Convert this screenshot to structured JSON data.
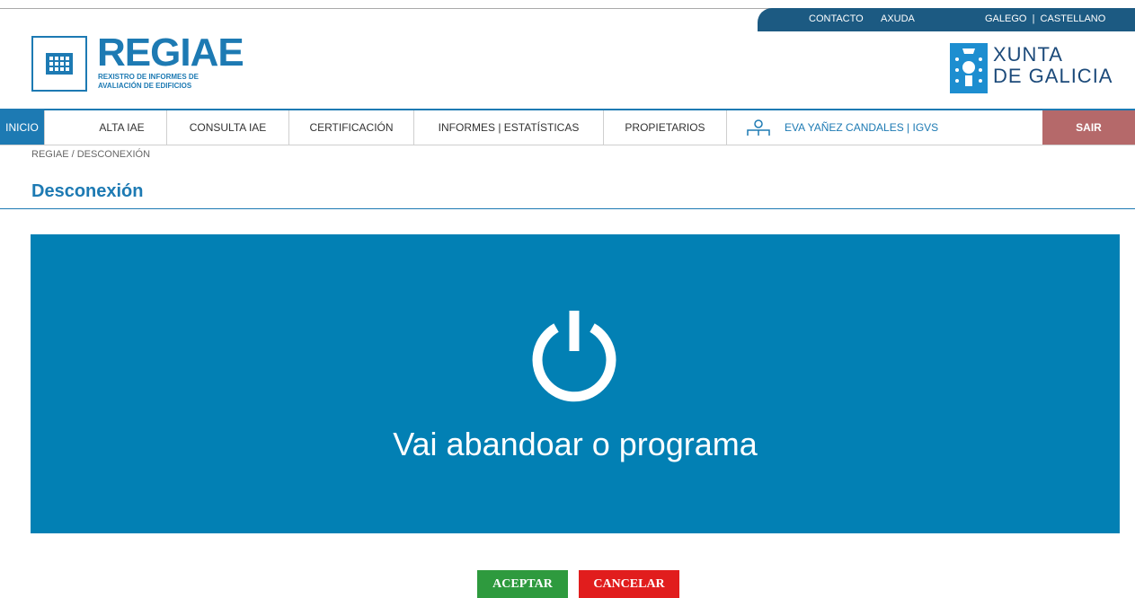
{
  "top_links": {
    "contacto": "CONTACTO",
    "axuda": "AXUDA",
    "languages": "GALEGO  |  CASTELLANO"
  },
  "brand": {
    "title": "REGIAE",
    "subtitle_line1": "REXISTRO DE INFORMES DE",
    "subtitle_line2": "AVALIACIÓN DE EDIFICIOS",
    "xunta_line1": "XUNTA",
    "xunta_line2": "DE GALICIA"
  },
  "nav": {
    "items": [
      {
        "label": "INICIO"
      },
      {
        "label": "ALTA IAE"
      },
      {
        "label": "CONSULTA IAE"
      },
      {
        "label": "CERTIFICACIÓN"
      },
      {
        "label": "INFORMES | ESTATÍSTICAS"
      },
      {
        "label": "PROPIETARIOS"
      }
    ],
    "user": "EVA YAÑEZ CANDALES | IGVS",
    "logout": "SAIR"
  },
  "breadcrumb": "REGIAE / DESCONEXIÓN",
  "page_title": "Desconexión",
  "panel": {
    "message": "Vai abandoar o programa",
    "icon": "power-icon"
  },
  "buttons": {
    "accept": "ACEPTAR",
    "cancel": "CANCELAR"
  },
  "colors": {
    "primary": "#1d7ab3",
    "panel_bg": "#0280b4",
    "accept_bg": "#2e9a3e",
    "cancel_bg": "#e11d1d",
    "logout_bg": "#b5696a",
    "top_bar_bg": "#1c5a82"
  }
}
